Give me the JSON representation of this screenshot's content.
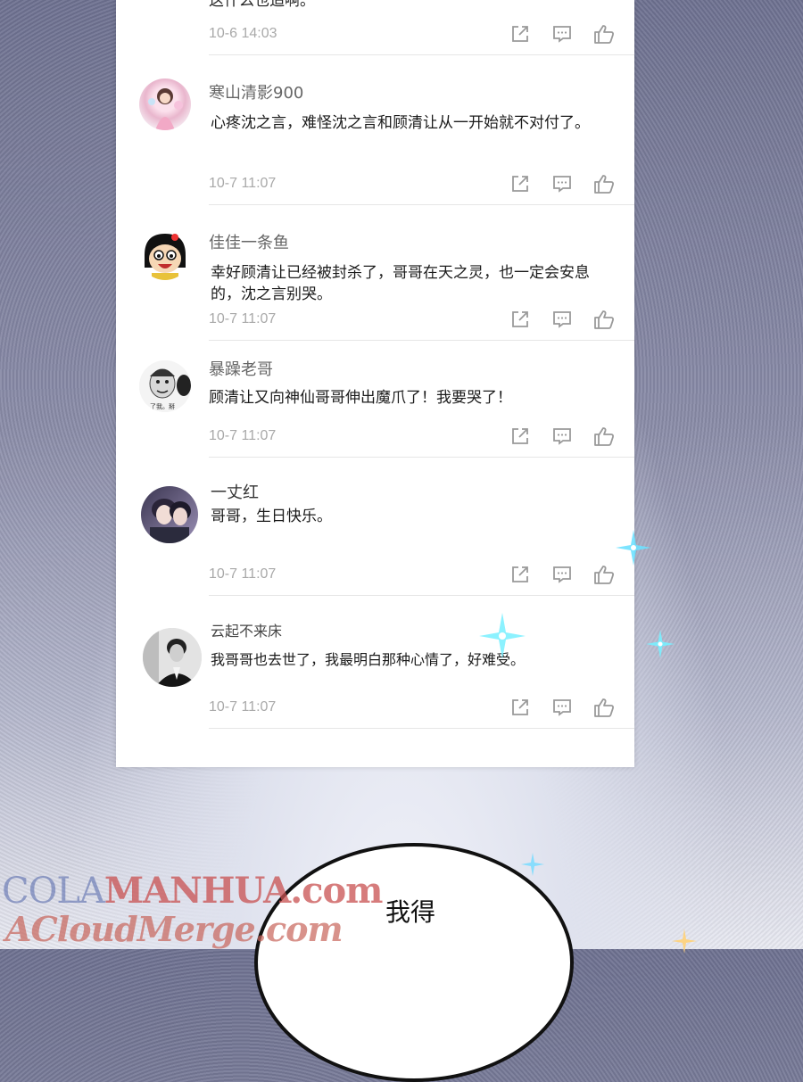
{
  "top_comment": {
    "text_fragment": "这什么也追啊。",
    "time": "10-6 14:03"
  },
  "comments": [
    {
      "user": "寒山清影900",
      "text": "心疼沈之言，难怪沈之言和顾清让从一开始就不对付了。",
      "time": "10-7 11:07",
      "avatar": "anime-girl-avatar"
    },
    {
      "user": "佳佳一条鱼",
      "text": "幸好顾清让已经被封杀了，哥哥在天之灵，也一定会安息的，沈之言别哭。",
      "time": "10-7 11:07",
      "avatar": "cartoon-face-avatar"
    },
    {
      "user": "暴躁老哥",
      "text": "顾清让又向神仙哥哥伸出魔爪了！我要哭了！",
      "time": "10-7 11:07",
      "avatar": "meme-face-avatar"
    },
    {
      "user": "一丈红",
      "text": "哥哥，生日快乐。",
      "time": "10-7 11:07",
      "avatar": "anime-boys-avatar"
    },
    {
      "user": "云起不来床",
      "text": "我哥哥也去世了，我最明白那种心情了，好难受。",
      "time": "10-7 11:07",
      "avatar": "man-photo-avatar"
    }
  ],
  "actions": {
    "share": "share-icon",
    "reply": "comment-icon",
    "like": "thumbs-up-icon"
  },
  "watermark": {
    "line1_prefix": "COLA",
    "line1_main": "MANHUA",
    "line1_suffix": ".com",
    "line2": "ACloudMerge.com"
  },
  "speech_bubble": {
    "text": "我得"
  },
  "colors": {
    "time_gray": "#a9a9a9",
    "name_gray": "#666666",
    "icon_gray": "#9a9a9a"
  }
}
